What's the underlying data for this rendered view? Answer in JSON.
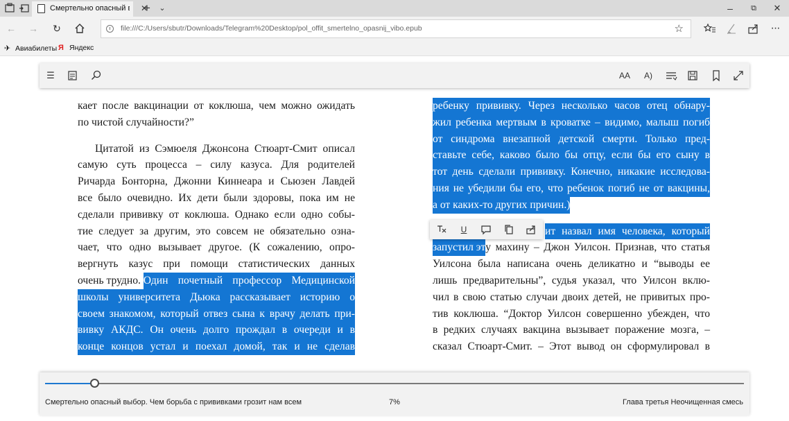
{
  "browser": {
    "tab_title": "Смертельно опасный в",
    "url": "file:///C:/Users/sbutr/Downloads/Telegram%20Desktop/pol_offit_smertelno_opasnij_vibo.epub",
    "favorites": [
      {
        "label": "Авиабилеты",
        "icon": "plane-icon"
      },
      {
        "label": "Яндекс",
        "icon": "yandex-icon"
      }
    ]
  },
  "colors": {
    "highlight": "#1476d3",
    "accent": "#1e78d0"
  },
  "book": {
    "left_column": [
      {
        "text": "кает после вакцинации от коклюша, чем можно ожидать",
        "highlighted": false
      },
      {
        "text": "по чистой случайности?”",
        "highlighted": false,
        "last": true
      },
      {
        "gap": true
      },
      {
        "text": "Цитатой из Сэмюеля Джонсона Стюарт-Смит описал",
        "highlighted": false,
        "indent": true
      },
      {
        "text": "самую суть процесса – силу казуса. Для родителей",
        "highlighted": false
      },
      {
        "text": "Ричарда Бонторна, Джонни Киннеара и Сьюзен Лавдей",
        "highlighted": false
      },
      {
        "text": "все было очевидно. Их дети были здоровы, пока им не",
        "highlighted": false
      },
      {
        "text": "сделали прививку от коклюша. Однако если одно собы-",
        "highlighted": false
      },
      {
        "text": "тие следует за другим, это совсем не обязательно озна-",
        "highlighted": false
      },
      {
        "text": "чает, что одно вызывает другое. (К сожалению, опро-",
        "highlighted": false
      },
      {
        "text": "вергнуть казус при помощи статистических данных",
        "highlighted": false
      },
      {
        "text": "очень трудно.",
        "hl_tail": "Один почетный профессор Медицинской",
        "mixed": true
      },
      {
        "text": "школы университета Дьюка рассказывает историю о",
        "highlighted": true
      },
      {
        "text": "своем знакомом, который отвез сына к врачу делать при-",
        "highlighted": true
      },
      {
        "text": "вивку АКДС. Он очень долго прождал в очереди и в",
        "highlighted": true
      },
      {
        "text": "конце концов устал и поехал домой, так и не сделав",
        "highlighted": true
      }
    ],
    "right_column": [
      {
        "text": "ребенку прививку. Через несколько часов отец обнару-",
        "highlighted": true
      },
      {
        "text": "жил ребенка мертвым в кроватке – видимо, малыш погиб",
        "highlighted": true
      },
      {
        "text": "от синдрома внезапной детской смерти. Только пред-",
        "highlighted": true
      },
      {
        "text": "ставьте себе, каково было бы отцу, если бы его сыну в",
        "highlighted": true
      },
      {
        "text": "тот день сделали прививку. Конечно, никакие исследова-",
        "highlighted": true
      },
      {
        "text": "ния не убедили бы его, что ребенок погиб не от вакцины,",
        "highlighted": true
      },
      {
        "text": "а от каких-то других причин.)",
        "highlighted": true,
        "last": true
      },
      {
        "gap": true
      },
      {
        "text": "",
        "hl_tail": "ит назвал имя человека, который",
        "mixed": true,
        "right_hl": true
      },
      {
        "text": "запустил эту",
        "hl_head": "запустил эт",
        "tail": "у махину – Джон Уилсон. Признав, что статья",
        "mixed_head": true
      },
      {
        "text": "Уилсона была написана очень деликатно и “выводы ее",
        "highlighted": false
      },
      {
        "text": "лишь предварительны”, судья указал, что Уилсон вклю-",
        "highlighted": false
      },
      {
        "text": "чил в свою статью случаи двоих детей, не привитых про-",
        "highlighted": false
      },
      {
        "text": "тив коклюша. “Доктор Уилсон совершенно убежден, что",
        "highlighted": false
      },
      {
        "text": "в редких случаях вакцина вызывает поражение мозга, –",
        "highlighted": false
      },
      {
        "text": "сказал Стюарт-Смит. – Этот вывод он сформулировал в",
        "highlighted": false
      }
    ]
  },
  "progress": {
    "book_title": "Смертельно опасный выбор. Чем борьба с прививками грозит нам всем",
    "percent": "7%",
    "percent_value": 0.07,
    "chapter": "Глава третья Неочищенная смесь"
  }
}
